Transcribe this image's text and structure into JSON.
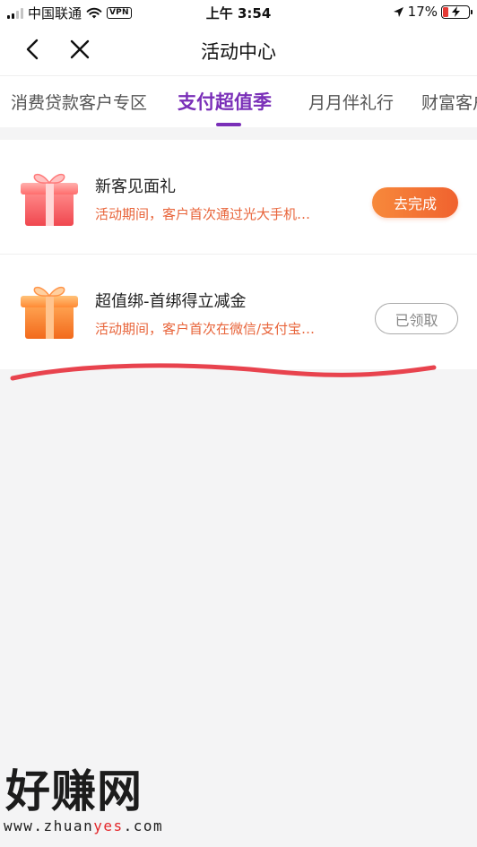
{
  "status_bar": {
    "carrier": "中国联通",
    "vpn": "VPN",
    "time": "上午 3:54",
    "battery_percent": "17%",
    "signal_bars": 4,
    "signal_bars_filled": 2,
    "battery_level": 0.17
  },
  "nav": {
    "title": "活动中心",
    "back_icon": "chevron-left-icon",
    "close_icon": "close-icon"
  },
  "tabs": [
    {
      "label": "消费贷款客户专区",
      "active": false
    },
    {
      "label": "支付超值季",
      "active": true
    },
    {
      "label": "月月伴礼行",
      "active": false
    },
    {
      "label": "财富客户",
      "active": false
    }
  ],
  "activities": [
    {
      "title": "新客见面礼",
      "desc": "活动期间，客户首次通过光大手机…",
      "button": "去完成",
      "icon": "gift-box-icon"
    },
    {
      "title": "超值绑-首绑得立减金",
      "desc": "活动期间，客户首次在微信/支付宝…",
      "button": "已领取",
      "icon": "gift-box-icon"
    }
  ],
  "watermark": {
    "brand": "好赚网",
    "url_prefix": "www.zhuan",
    "url_accent": "yes",
    "url_suffix": ".com"
  },
  "colors": {
    "accent_purple": "#7a2fb8",
    "orange_button": "#f0622f",
    "desc_orange": "#e8643a",
    "stroke_red": "#e8434e"
  }
}
